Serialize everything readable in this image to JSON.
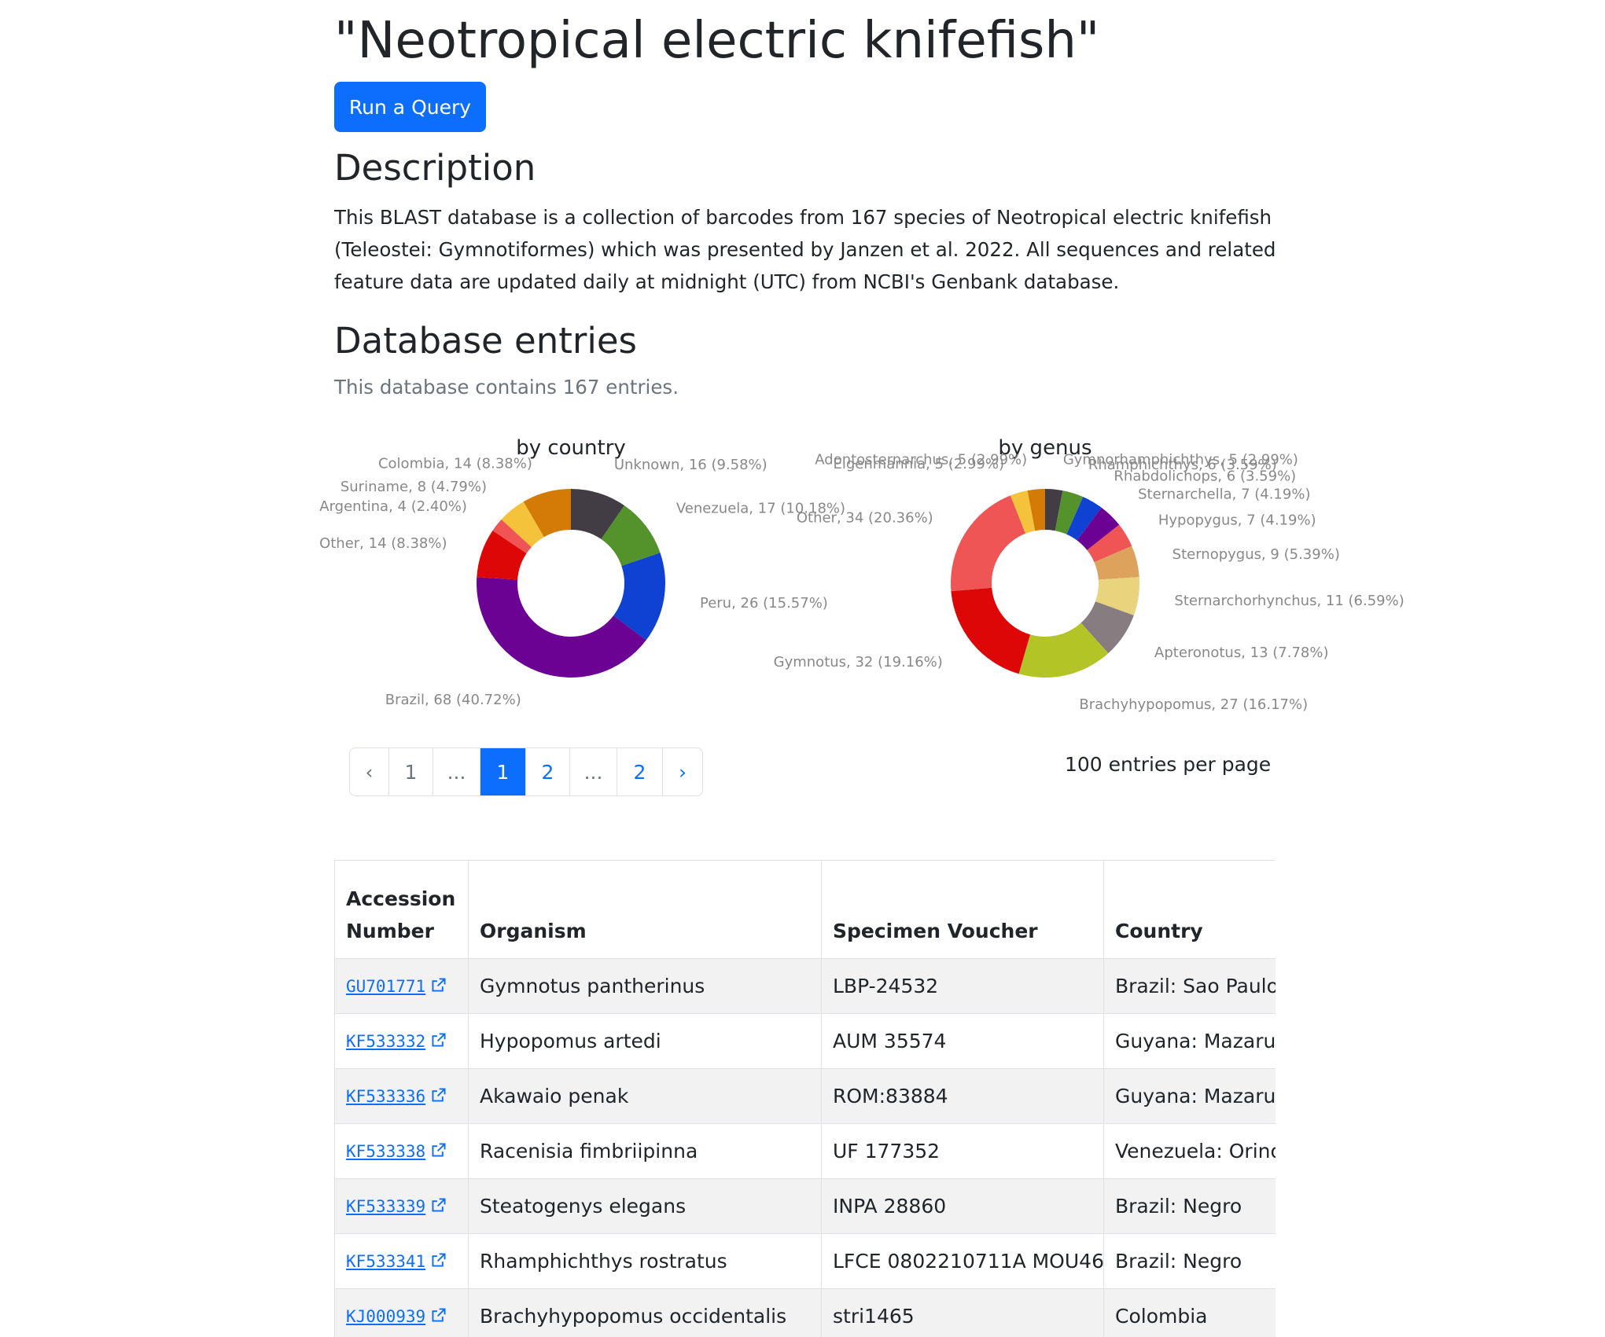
{
  "header": {
    "title": "\"Neotropical electric knifefish\"",
    "run_query_label": "Run a Query"
  },
  "description": {
    "heading": "Description",
    "text": "This BLAST database is a collection of barcodes from 167 species of Neotropical electric knifefish (Teleostei: Gymnotiformes) which was presented by Janzen et al. 2022. All sequences and related feature data are updated daily at midnight (UTC) from NCBI's Genbank database."
  },
  "entries": {
    "heading": "Database entries",
    "summary": "This database contains 167 entries."
  },
  "chart_data": [
    {
      "type": "pie",
      "title": "by country",
      "slices": [
        {
          "label": "Unknown",
          "value": 16,
          "percent": "9.58%",
          "color": "#423d44"
        },
        {
          "label": "Venezuela",
          "value": 17,
          "percent": "10.18%",
          "color": "#54922c"
        },
        {
          "label": "Peru",
          "value": 26,
          "percent": "15.57%",
          "color": "#0f41d2"
        },
        {
          "label": "Brazil",
          "value": 68,
          "percent": "40.72%",
          "color": "#6c0293"
        },
        {
          "label": "Other",
          "value": 14,
          "percent": "8.38%",
          "color": "#dc0706"
        },
        {
          "label": "Argentina",
          "value": 4,
          "percent": "2.40%",
          "color": "#ef5555"
        },
        {
          "label": "Suriname",
          "value": 8,
          "percent": "4.79%",
          "color": "#f5c23b"
        },
        {
          "label": "Colombia",
          "value": 14,
          "percent": "8.38%",
          "color": "#d47a07"
        }
      ]
    },
    {
      "type": "pie",
      "title": "by genus",
      "slices": [
        {
          "label": "Gymnorhamphichthys",
          "value": 5,
          "percent": "2.99%",
          "color": "#423d44"
        },
        {
          "label": "Rhamphichthys",
          "value": 6,
          "percent": "3.59%",
          "color": "#54922c"
        },
        {
          "label": "Rhabdolichops",
          "value": 6,
          "percent": "3.59%",
          "color": "#0f41d2"
        },
        {
          "label": "Sternarchella",
          "value": 7,
          "percent": "4.19%",
          "color": "#6c0293"
        },
        {
          "label": "Hypopygus",
          "value": 7,
          "percent": "4.19%",
          "color": "#ef5555"
        },
        {
          "label": "Sternopygus",
          "value": 9,
          "percent": "5.39%",
          "color": "#dda35d"
        },
        {
          "label": "Sternarchorhynchus",
          "value": 11,
          "percent": "6.59%",
          "color": "#ead37d"
        },
        {
          "label": "Apteronotus",
          "value": 13,
          "percent": "7.78%",
          "color": "#877c80"
        },
        {
          "label": "Brachyhypopomus",
          "value": 27,
          "percent": "16.17%",
          "color": "#b3c427"
        },
        {
          "label": "Gymnotus",
          "value": 32,
          "percent": "19.16%",
          "color": "#dc0706"
        },
        {
          "label": "Other",
          "value": 34,
          "percent": "20.36%",
          "color": "#ef5555"
        },
        {
          "label": "Eigenmannia",
          "value": 5,
          "percent": "2.99%",
          "color": "#f5c23b"
        },
        {
          "label": "Adontosternarchus",
          "value": 5,
          "percent": "2.99%",
          "color": "#d47a07"
        }
      ]
    }
  ],
  "pagination": {
    "items": [
      {
        "label": "‹",
        "state": "disabled"
      },
      {
        "label": "1",
        "state": "disabled"
      },
      {
        "label": "...",
        "state": "disabled"
      },
      {
        "label": "1",
        "state": "active"
      },
      {
        "label": "2",
        "state": "normal"
      },
      {
        "label": "...",
        "state": "disabled"
      },
      {
        "label": "2",
        "state": "normal"
      },
      {
        "label": "›",
        "state": "normal"
      }
    ],
    "per_page_label": "100 entries per page"
  },
  "table": {
    "columns": [
      "Accession Number",
      "Organism",
      "Specimen Voucher",
      "Country"
    ],
    "rows": [
      {
        "accession": "GU701771",
        "organism": "Gymnotus pantherinus",
        "voucher": "LBP-24532",
        "country": "Brazil: Sao Paulo,"
      },
      {
        "accession": "KF533332",
        "organism": "Hypopomus artedi",
        "voucher": "AUM 35574",
        "country": "Guyana: Mazarun"
      },
      {
        "accession": "KF533336",
        "organism": "Akawaio penak",
        "voucher": "ROM:83884",
        "country": "Guyana: Mazarun"
      },
      {
        "accession": "KF533338",
        "organism": "Racenisia fimbriipinna",
        "voucher": "UF 177352",
        "country": "Venezuela: Orinoc"
      },
      {
        "accession": "KF533339",
        "organism": "Steatogenys elegans",
        "voucher": "INPA 28860",
        "country": "Brazil: Negro"
      },
      {
        "accession": "KF533341",
        "organism": "Rhamphichthys rostratus",
        "voucher": "LFCE 0802210711A MOU46",
        "country": "Brazil: Negro"
      },
      {
        "accession": "KJ000939",
        "organism": "Brachyhypopomus occidentalis",
        "voucher": "stri1465",
        "country": "Colombia"
      }
    ]
  }
}
